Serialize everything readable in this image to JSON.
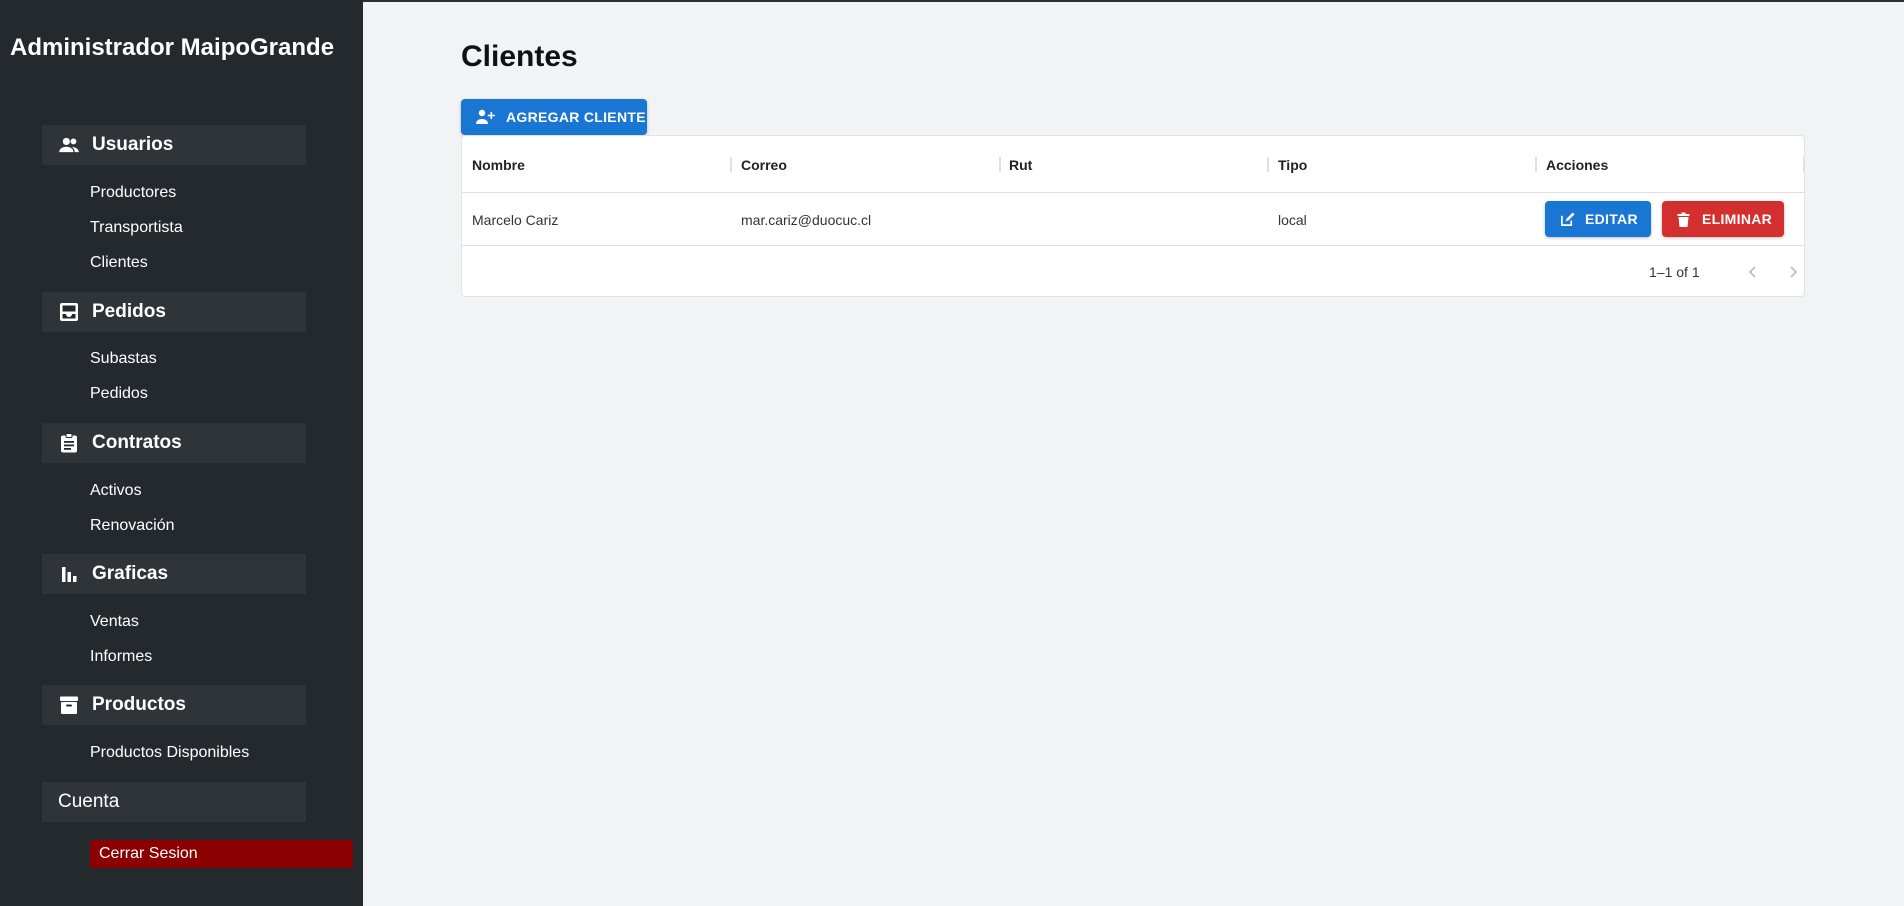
{
  "app": {
    "title": "Administrador MaipoGrande"
  },
  "sidebar": {
    "sections": [
      {
        "label": "Usuarios",
        "icon": "users-icon",
        "links": [
          "Productores",
          "Transportista",
          "Clientes"
        ]
      },
      {
        "label": "Pedidos",
        "icon": "inbox-icon",
        "links": [
          "Subastas",
          "Pedidos"
        ]
      },
      {
        "label": "Contratos",
        "icon": "clipboard-icon",
        "links": [
          "Activos",
          "Renovación"
        ]
      },
      {
        "label": "Graficas",
        "icon": "bar-chart-icon",
        "links": [
          "Ventas",
          "Informes"
        ]
      },
      {
        "label": "Productos",
        "icon": "archive-icon",
        "links": [
          "Productos Disponibles"
        ]
      }
    ],
    "account": {
      "label": "Cuenta",
      "logout_label": "Cerrar Sesion"
    }
  },
  "main": {
    "title": "Clientes",
    "add_button_label": "AGREGAR CLIENTE",
    "table": {
      "columns": [
        "Nombre",
        "Correo",
        "Rut",
        "Tipo",
        "Acciones"
      ],
      "rows": [
        {
          "nombre": "Marcelo Cariz",
          "correo": "mar.cariz@duocuc.cl",
          "rut": "",
          "tipo": "local"
        }
      ],
      "edit_label": "EDITAR",
      "delete_label": "ELIMINAR",
      "pagination": "1–1 of 1"
    }
  },
  "colors": {
    "sidebar": "#24292e",
    "primary": "#1976d2",
    "danger": "#d32f2f",
    "logout": "#8b0000"
  }
}
